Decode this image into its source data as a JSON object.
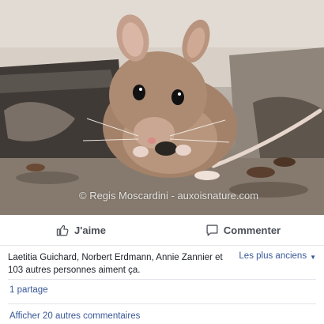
{
  "photo": {
    "alt_subject": "mouse",
    "watermark": "© Regis Moscardini - auxoisnature.com"
  },
  "actions": {
    "like_label": "J'aime",
    "comment_label": "Commenter"
  },
  "summary": {
    "likes_text": "Laetitia Guichard, Norbert Erdmann, Annie Zannier et 103 autres personnes aiment ça.",
    "sort_label": "Les plus anciens"
  },
  "shares_text": "1 partage",
  "more_comments_text": "Afficher 20 autres commentaires",
  "colors": {
    "link": "#385898",
    "action_text": "#4b4f56",
    "divider": "#e4e6eb"
  },
  "icons": {
    "like": "thumbs-up-icon",
    "comment": "speech-bubble-icon",
    "sort": "caret-down-icon"
  }
}
